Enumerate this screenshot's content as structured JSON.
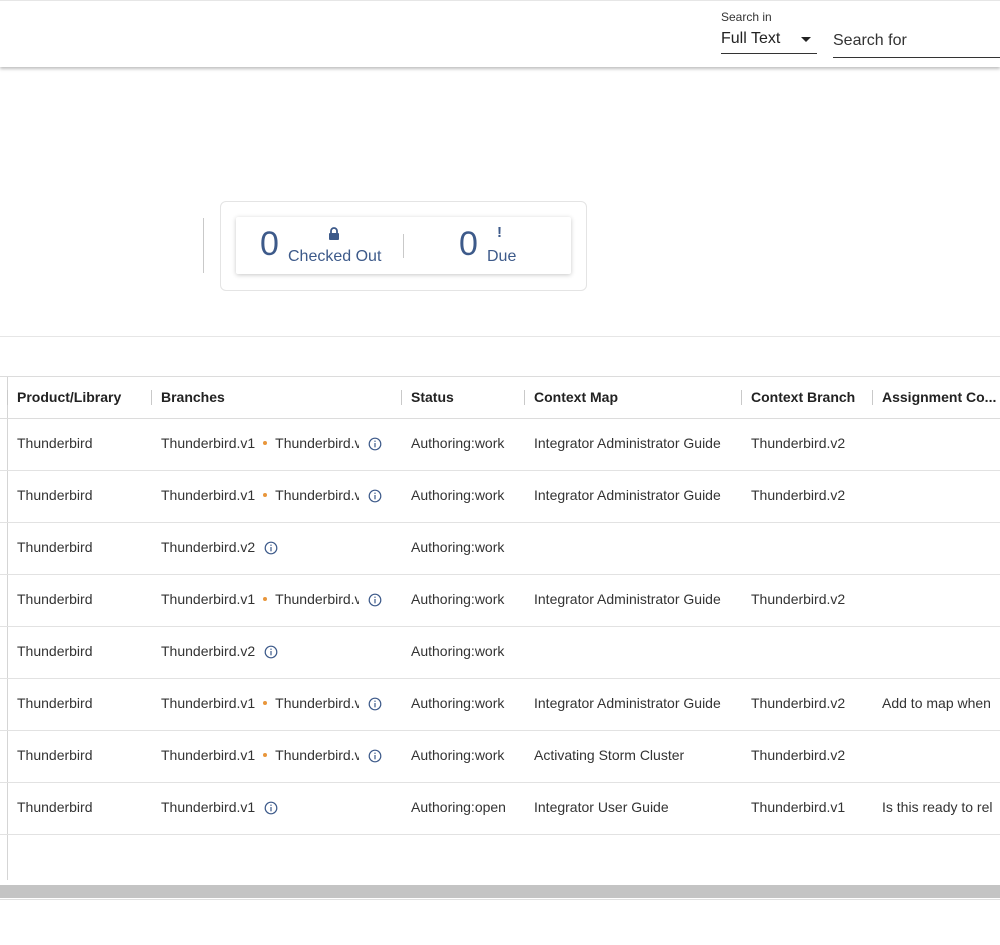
{
  "header": {
    "search_in_label": "Search in",
    "search_in_value": "Full Text",
    "search_for_placeholder": "Search for"
  },
  "status": {
    "checked_out_count": "0",
    "checked_out_label": "Checked Out",
    "due_count": "0",
    "due_label": "Due",
    "due_icon": "!"
  },
  "table": {
    "columns": [
      "Product/Library",
      "Branches",
      "Status",
      "Context Map",
      "Context Branch",
      "Assignment Co..."
    ],
    "rows": [
      {
        "product": "Thunderbird",
        "branch1": "Thunderbird.v1",
        "branch2": "Thunderbird.v",
        "status": "Authoring:work",
        "context_map": "Integrator Administrator Guide",
        "context_branch": "Thunderbird.v2",
        "assignment": ""
      },
      {
        "product": "Thunderbird",
        "branch1": "Thunderbird.v1",
        "branch2": "Thunderbird.v",
        "status": "Authoring:work",
        "context_map": "Integrator Administrator Guide",
        "context_branch": "Thunderbird.v2",
        "assignment": ""
      },
      {
        "product": "Thunderbird",
        "branch1": "Thunderbird.v2",
        "branch2": "",
        "status": "Authoring:work",
        "context_map": "",
        "context_branch": "",
        "assignment": ""
      },
      {
        "product": "Thunderbird",
        "branch1": "Thunderbird.v1",
        "branch2": "Thunderbird.v",
        "status": "Authoring:work",
        "context_map": "Integrator Administrator Guide",
        "context_branch": "Thunderbird.v2",
        "assignment": ""
      },
      {
        "product": "Thunderbird",
        "branch1": "Thunderbird.v2",
        "branch2": "",
        "status": "Authoring:work",
        "context_map": "",
        "context_branch": "",
        "assignment": ""
      },
      {
        "product": "Thunderbird",
        "branch1": "Thunderbird.v1",
        "branch2": "Thunderbird.v",
        "status": "Authoring:work",
        "context_map": "Integrator Administrator Guide",
        "context_branch": "Thunderbird.v2",
        "assignment": "Add to map when"
      },
      {
        "product": "Thunderbird",
        "branch1": "Thunderbird.v1",
        "branch2": "Thunderbird.v",
        "status": "Authoring:work",
        "context_map": "Activating Storm Cluster",
        "context_branch": "Thunderbird.v2",
        "assignment": ""
      },
      {
        "product": "Thunderbird",
        "branch1": "Thunderbird.v1",
        "branch2": "",
        "status": "Authoring:open",
        "context_map": "Integrator User Guide",
        "context_branch": "Thunderbird.v1",
        "assignment": "Is this ready to rel"
      }
    ]
  },
  "colors": {
    "accent_blue": "#3d5a8a",
    "branch_dot": "#e8963c"
  }
}
